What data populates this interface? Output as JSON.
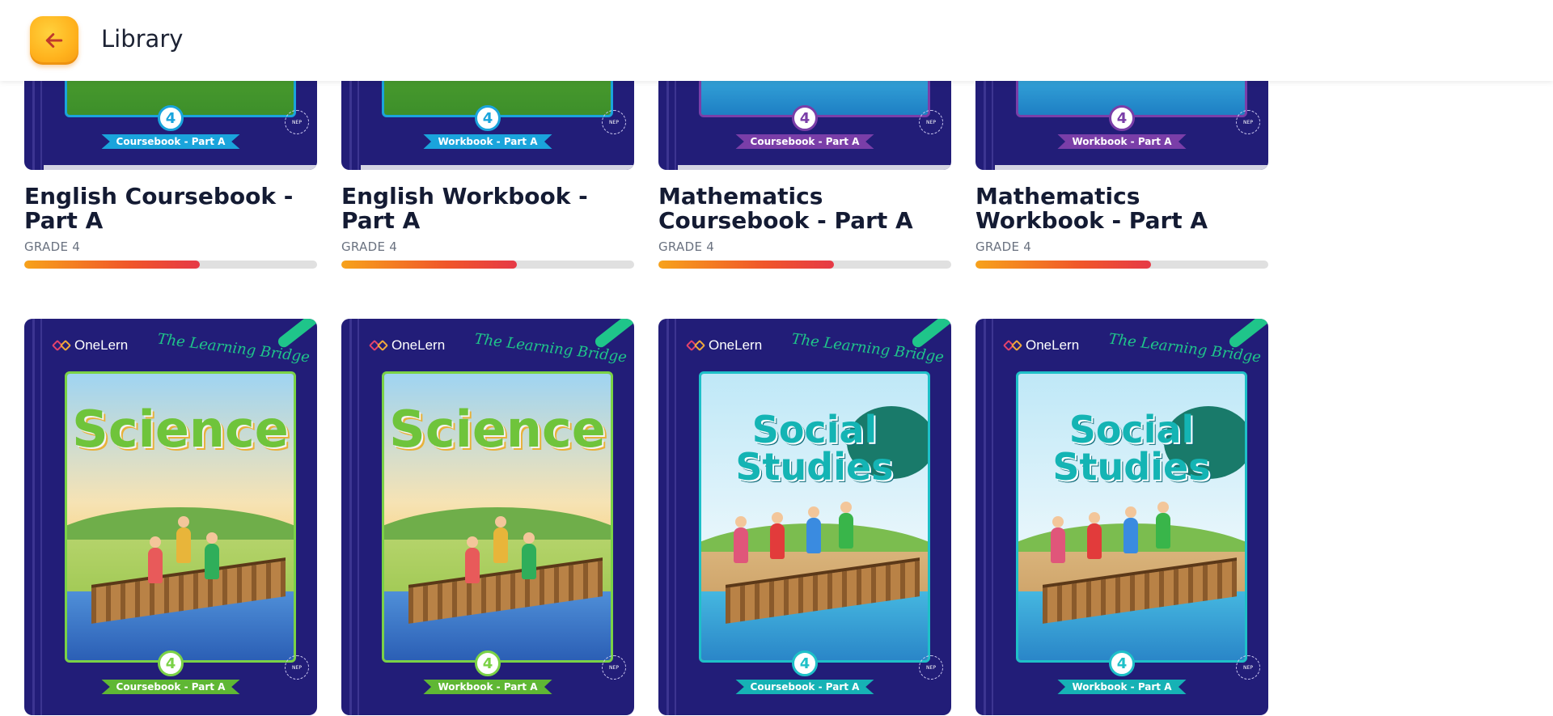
{
  "header": {
    "title": "Library",
    "back_icon": "arrow-left-icon",
    "accent": "#ffb21d"
  },
  "publisher": "OneLern",
  "tagline": "The Learning Bridge",
  "nep_badge": "NEP",
  "progress_color": "#e63946",
  "books_row1": [
    {
      "title": "English Coursebook - Part A",
      "grade": "GRADE 4",
      "grade_num": "4",
      "label": "Coursebook - Part A",
      "progress": 0.6
    },
    {
      "title": "English Workbook - Part A",
      "grade": "GRADE 4",
      "grade_num": "4",
      "label": "Workbook - Part A",
      "progress": 0.6
    },
    {
      "title": "Mathematics Coursebook - Part A",
      "grade": "GRADE 4",
      "grade_num": "4",
      "label": "Coursebook - Part A",
      "progress": 0.6
    },
    {
      "title": "Mathematics Workbook - Part A",
      "grade": "GRADE 4",
      "grade_num": "4",
      "label": "Workbook - Part A",
      "progress": 0.6
    }
  ],
  "books_row2": [
    {
      "subject": "Science",
      "grade_num": "4",
      "label": "Coursebook - Part A"
    },
    {
      "subject": "Science",
      "grade_num": "4",
      "label": "Workbook - Part A"
    },
    {
      "subject": "Social Studies",
      "grade_num": "4",
      "label": "Coursebook - Part A"
    },
    {
      "subject": "Social Studies",
      "grade_num": "4",
      "label": "Workbook - Part A"
    }
  ]
}
